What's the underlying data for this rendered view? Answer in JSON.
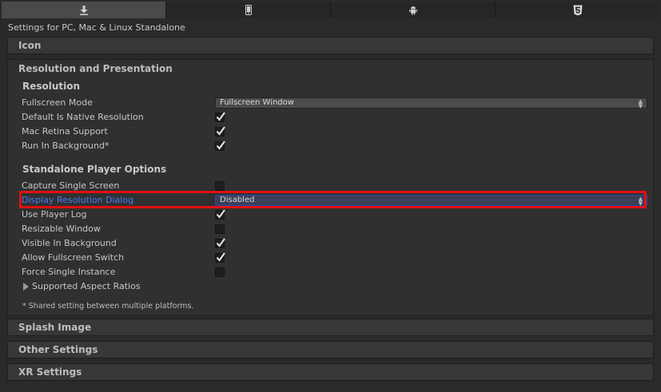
{
  "tabs": [
    {
      "icon": "download-arrow-icon",
      "active": true
    },
    {
      "icon": "mobile-phone-icon",
      "active": false
    },
    {
      "icon": "android-icon",
      "active": false
    },
    {
      "icon": "html5-icon",
      "active": false
    }
  ],
  "settings_title": "Settings for PC, Mac & Linux Standalone",
  "sections": {
    "icon": "Icon",
    "resolution_presentation": "Resolution and Presentation",
    "splash_image": "Splash Image",
    "other_settings": "Other Settings",
    "xr_settings": "XR Settings"
  },
  "resolution": {
    "heading": "Resolution",
    "fullscreen_mode_label": "Fullscreen Mode",
    "fullscreen_mode_value": "Fullscreen Window",
    "default_native_label": "Default Is Native Resolution",
    "default_native_checked": true,
    "mac_retina_label": "Mac Retina Support",
    "mac_retina_checked": true,
    "run_background_label": "Run In Background*",
    "run_background_checked": true
  },
  "standalone": {
    "heading": "Standalone Player Options",
    "capture_single_label": "Capture Single Screen",
    "capture_single_checked": false,
    "display_dialog_label": "Display Resolution Dialog",
    "display_dialog_value": "Disabled",
    "use_player_log_label": "Use Player Log",
    "use_player_log_checked": true,
    "resizable_window_label": "Resizable Window",
    "resizable_window_checked": false,
    "visible_background_label": "Visible In Background",
    "visible_background_checked": true,
    "allow_fullscreen_label": "Allow Fullscreen Switch",
    "allow_fullscreen_checked": true,
    "force_single_label": "Force Single Instance",
    "force_single_checked": false,
    "aspect_ratios_label": "Supported Aspect Ratios"
  },
  "footnote": "* Shared setting between multiple platforms.",
  "colors": {
    "highlight_label": "#4c7bff",
    "focus_outline": "#e01010"
  }
}
